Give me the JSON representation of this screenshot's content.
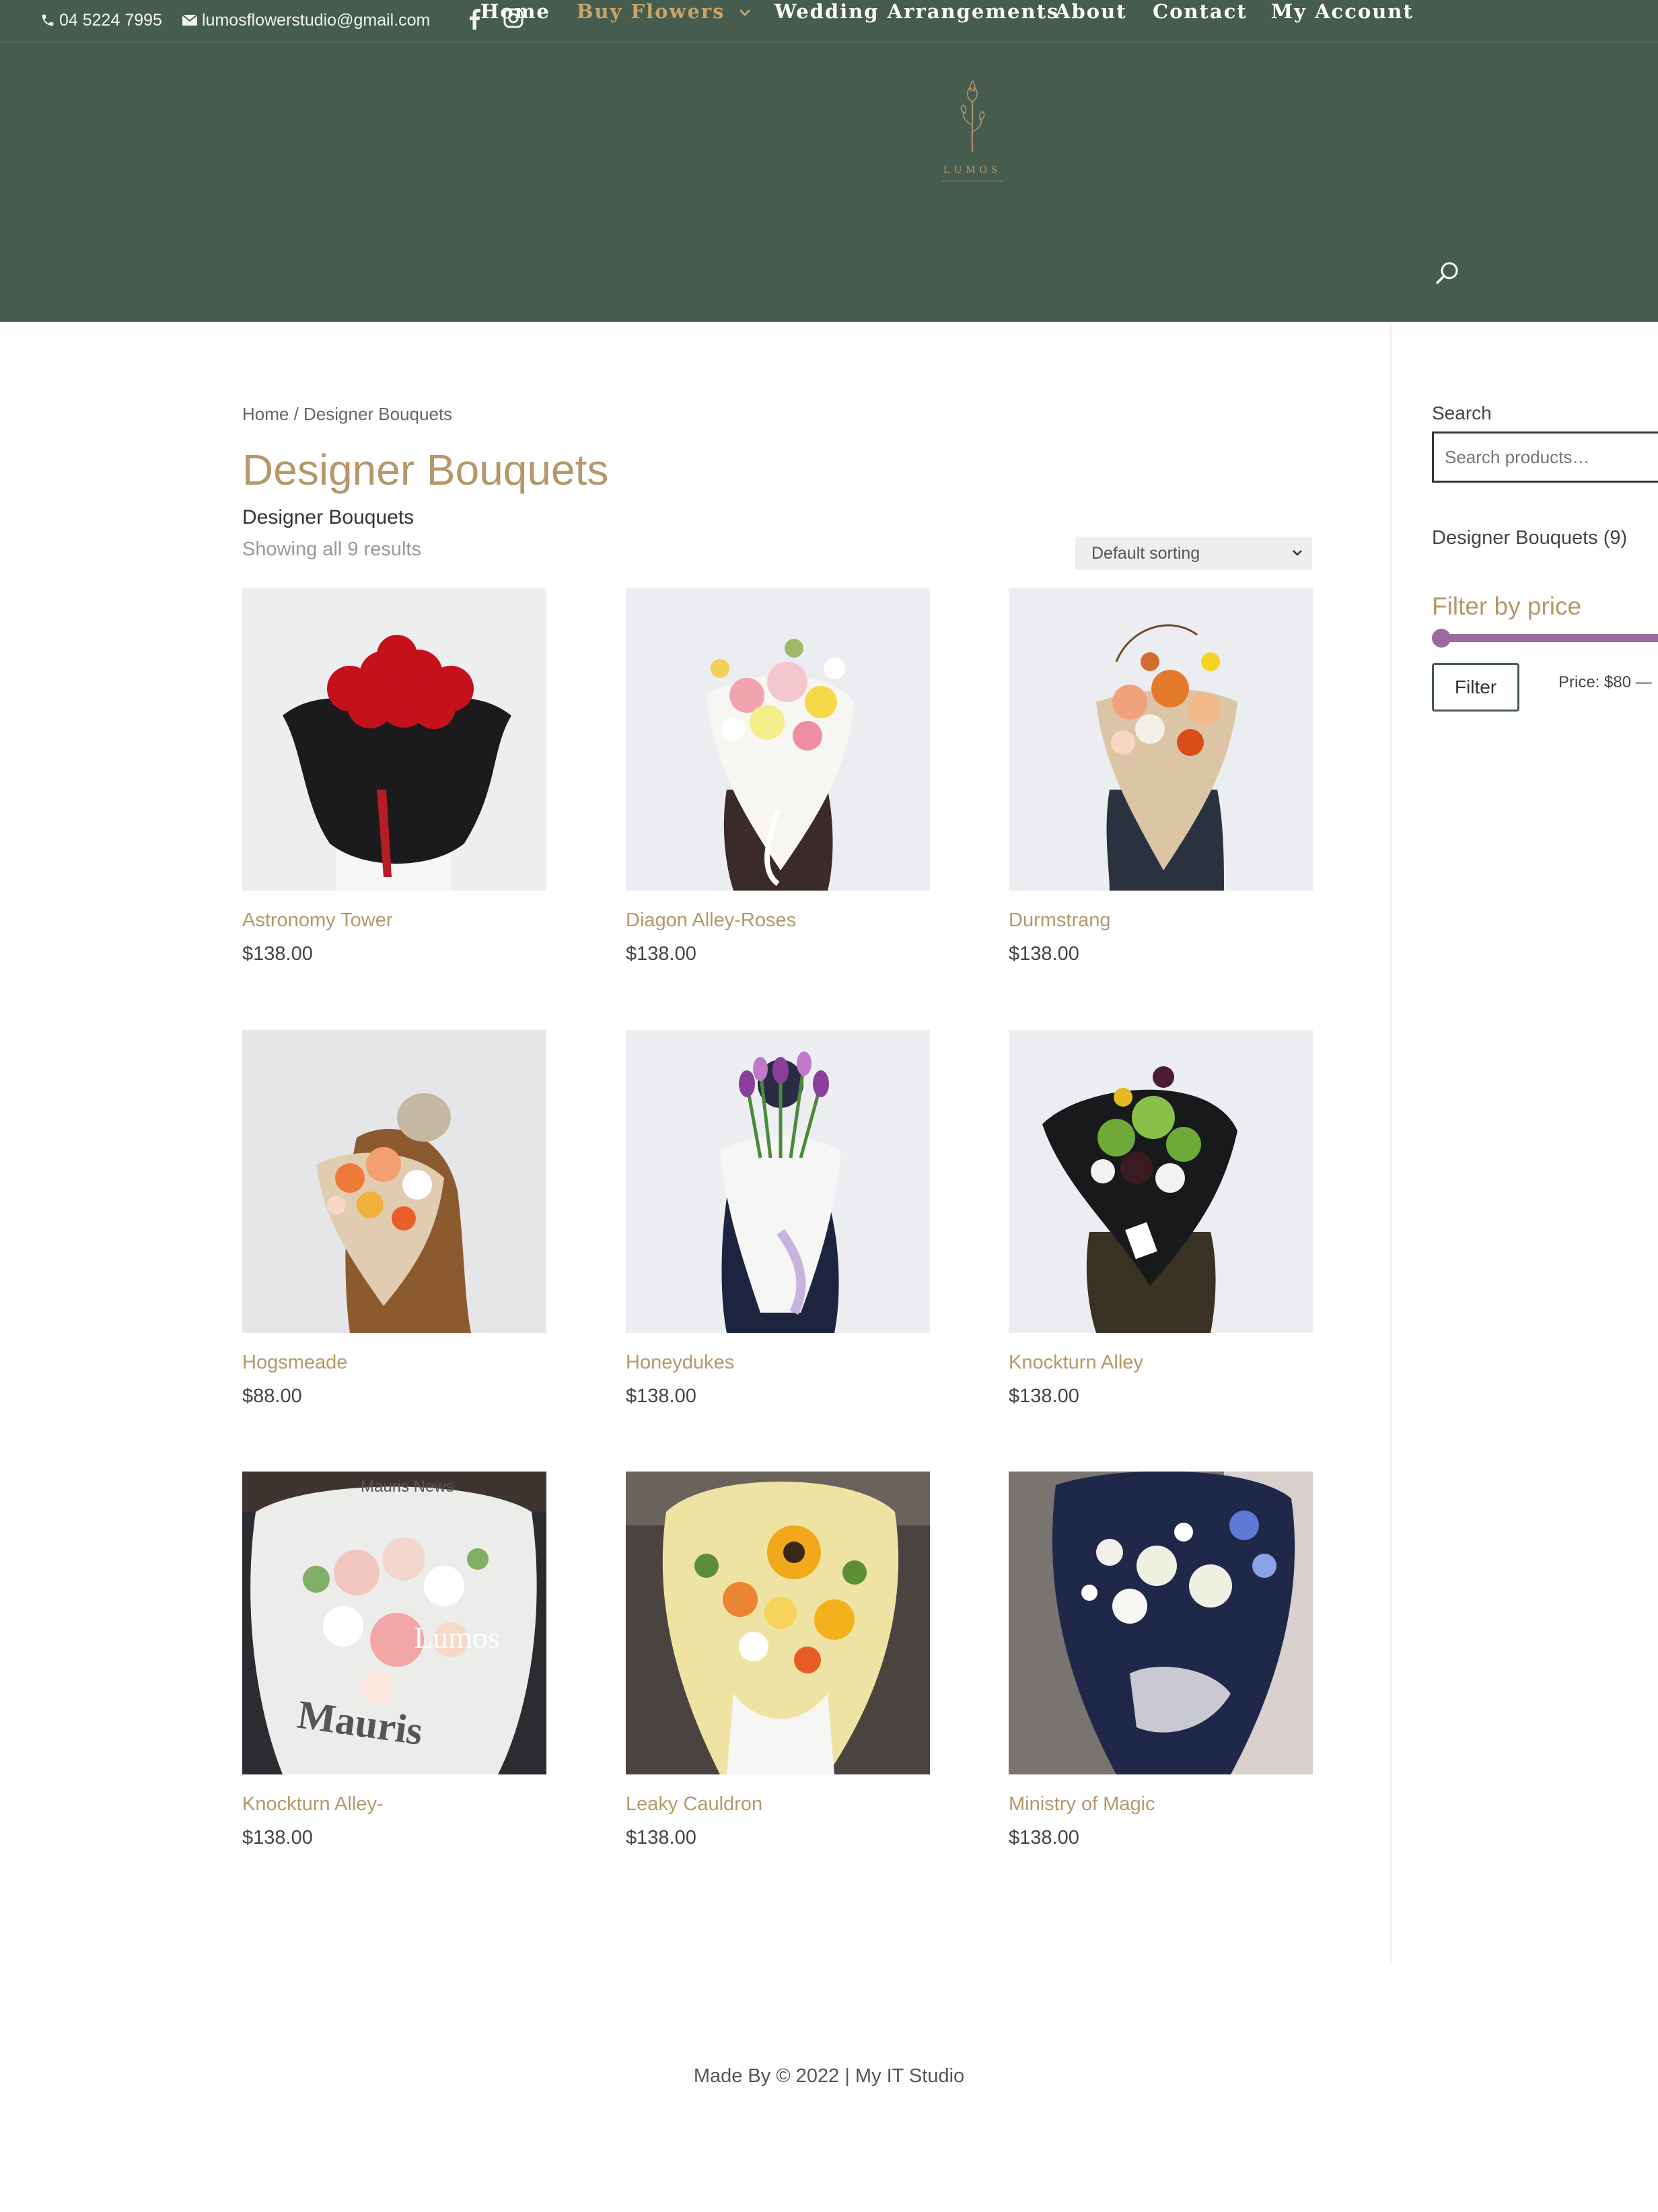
{
  "topbar": {
    "phone": "04 5224 7995",
    "email": "lumosflowerstudio@gmail.com"
  },
  "brand": {
    "logo_text": "LUMOS"
  },
  "nav": {
    "items": [
      {
        "label": "Home"
      },
      {
        "label": "Buy Flowers"
      },
      {
        "label": "Wedding Arrangements"
      },
      {
        "label": "About"
      },
      {
        "label": "Contact"
      },
      {
        "label": "My Account"
      }
    ]
  },
  "breadcrumb": "Home / Designer Bouquets",
  "page": {
    "title": "Designer Bouquets",
    "description": "Designer Bouquets",
    "results": "Showing all 9 results",
    "sort_selected": "Default sorting"
  },
  "products": [
    {
      "name": "Astronomy Tower",
      "price": "$138.00"
    },
    {
      "name": "Diagon Alley-Roses",
      "price": "$138.00"
    },
    {
      "name": "Durmstrang",
      "price": "$138.00"
    },
    {
      "name": "Hogsmeade",
      "price": "$88.00"
    },
    {
      "name": "Honeydukes",
      "price": "$138.00"
    },
    {
      "name": "Knockturn Alley",
      "price": "$138.00"
    },
    {
      "name": "Knockturn Alley-",
      "price": "$138.00"
    },
    {
      "name": "Leaky Cauldron",
      "price": "$138.00"
    },
    {
      "name": "Ministry of Magic",
      "price": "$138.00"
    }
  ],
  "image_text": {
    "newspaper": "Mauris News",
    "brand": "Lumos"
  },
  "sidebar": {
    "search_label": "Search",
    "search_placeholder": "Search products…",
    "category": "Designer Bouquets (9)",
    "filter_title": "Filter by price",
    "filter_button": "Filter",
    "price_text": "Price: $80 —"
  },
  "footer": {
    "text": "Made By © 2022 | My IT Studio"
  },
  "colors": {
    "header_bg": "#465c4f",
    "accent_gold": "#b6976a",
    "nav_active": "#c9a466",
    "slider": "#9c6a9d"
  }
}
